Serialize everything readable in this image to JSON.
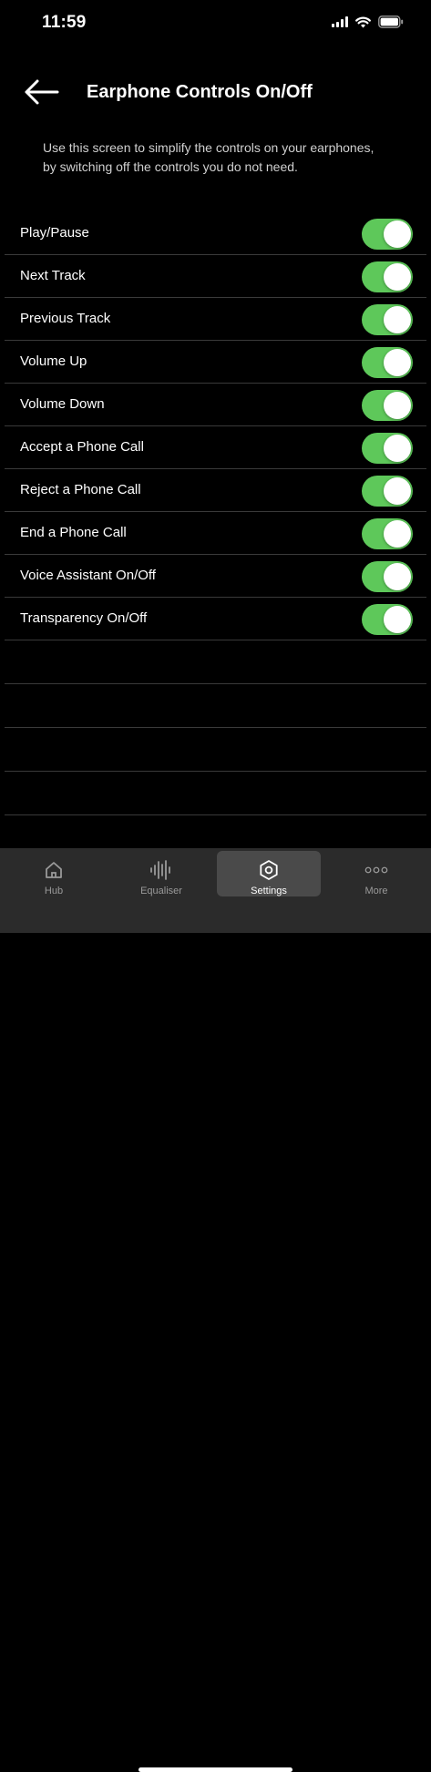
{
  "status_bar": {
    "time": "11:59",
    "icons": [
      "cellular-signal-icon",
      "wifi-icon",
      "battery-icon"
    ]
  },
  "header": {
    "back_icon": "arrow-left-icon",
    "title": "Earphone Controls On/Off"
  },
  "description": "Use this screen to simplify the controls on your earphones, by switching off the controls you do not need.",
  "controls": [
    {
      "label": "Play/Pause",
      "enabled": true
    },
    {
      "label": "Next Track",
      "enabled": true
    },
    {
      "label": "Previous Track",
      "enabled": true
    },
    {
      "label": "Volume Up",
      "enabled": true
    },
    {
      "label": "Volume Down",
      "enabled": true
    },
    {
      "label": "Accept a Phone Call",
      "enabled": true
    },
    {
      "label": "Reject a Phone Call",
      "enabled": true
    },
    {
      "label": "End a Phone Call",
      "enabled": true
    },
    {
      "label": "Voice Assistant On/Off",
      "enabled": true
    },
    {
      "label": "Transparency On/Off",
      "enabled": true
    }
  ],
  "tab_bar": {
    "active": "Settings",
    "tabs": [
      {
        "label": "Hub",
        "icon": "home-icon"
      },
      {
        "label": "Equaliser",
        "icon": "equaliser-waveform-icon"
      },
      {
        "label": "Settings",
        "icon": "settings-hexagon-icon"
      },
      {
        "label": "More",
        "icon": "more-dots-icon"
      }
    ]
  },
  "colors": {
    "background": "#000000",
    "toggle_on": "#5ec85a",
    "divider": "#3a3a3a",
    "tab_bar": "#2b2b2b",
    "tab_active": "#4a4a4a"
  }
}
